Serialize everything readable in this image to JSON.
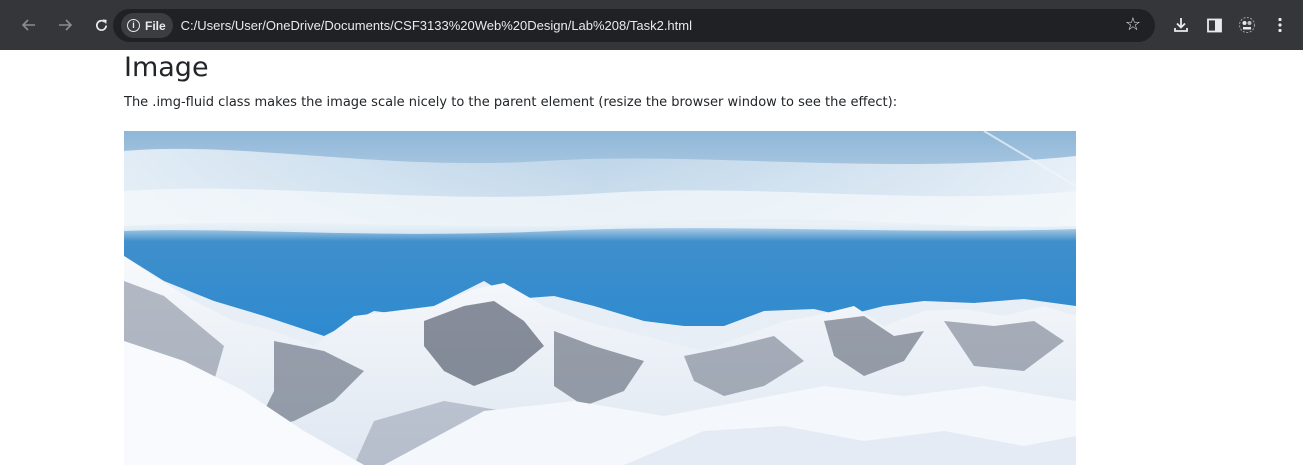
{
  "browser": {
    "back_icon": "arrow-left-icon",
    "forward_icon": "arrow-right-icon",
    "reload_icon": "reload-icon",
    "site_info": {
      "icon": "info-icon",
      "label": "File"
    },
    "address": "C:/Users/User/OneDrive/Documents/CSF3133%20Web%20Design/Lab%208/Task2.html",
    "bookmark_icon": "star-icon",
    "toolbar_icons": [
      "download-icon",
      "side-panel-icon",
      "extensions-icon",
      "menu-icon"
    ]
  },
  "page": {
    "title": "Image",
    "description": "The .img-fluid class makes the image scale nicely to the parent element (resize the browser window to see the effect):",
    "image": {
      "subject": "snow-covered mountain range under a blue sky",
      "colors": {
        "sky_top": "#9fc1dc",
        "sky_mid": "#2f86c8",
        "snow": "#f3f6fa",
        "rock": "#4d5566"
      }
    }
  }
}
